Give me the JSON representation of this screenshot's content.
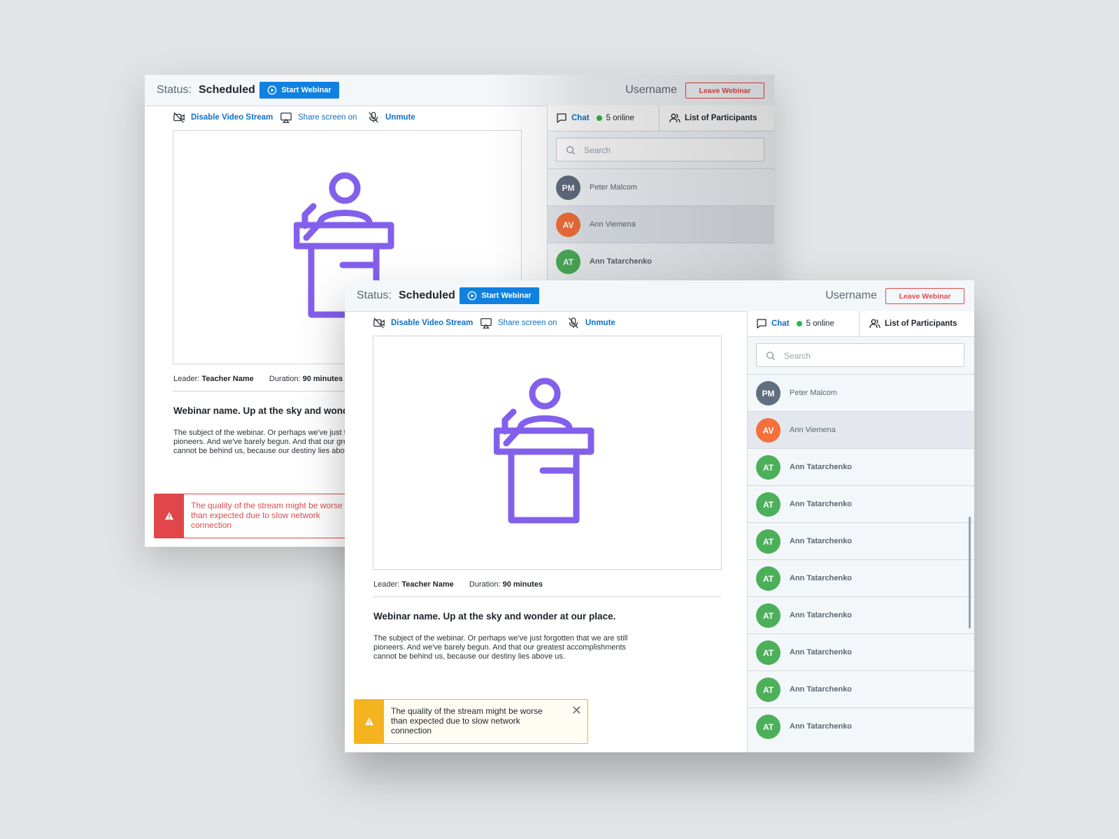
{
  "colors": {
    "accent": "#1081e0",
    "link": "#1070c8",
    "danger": "#e04a4a",
    "warning": "#f3b420",
    "online": "#2fb84c",
    "podium": "#8360ec"
  },
  "windows": [
    {
      "header": {
        "status_label": "Status:",
        "status_value": "Scheduled",
        "start_button": "Start Webinar",
        "username": "Username",
        "leave_button": "Leave Webinar"
      },
      "toolbar": {
        "video": "Disable Video Stream",
        "share": "Share screen on",
        "unmute": "Unmute"
      },
      "meta": {
        "leader_label": "Leader:",
        "leader_value": "Teacher Name",
        "duration_label": "Duration:",
        "duration_value": "90 minutes"
      },
      "webinar_title": "Webinar name. Up at the sky and wonder at our place.",
      "description": "The subject of the webinar. Or perhaps we've just forgotten that we are still pioneers. And we've barely begun. And that our greatest accomplishments cannot be behind us, because our destiny lies above us.",
      "toast": {
        "type": "error",
        "message": "The quality of the stream might be worse than expected due to slow network connection"
      },
      "sidebar": {
        "chat_tab": "Chat",
        "online_count": "5 online",
        "participants_tab": "List of Participants",
        "search_placeholder": "Search",
        "participants": [
          {
            "initials": "PM",
            "name": "Peter Malcom",
            "color": "#616e7f"
          },
          {
            "initials": "AV",
            "name": "Ann Viemena",
            "color": "#f5703a"
          },
          {
            "initials": "AT",
            "name": "Ann Tatarchenko",
            "color": "#4cb05a"
          }
        ]
      }
    },
    {
      "header": {
        "status_label": "Status:",
        "status_value": "Scheduled",
        "start_button": "Start Webinar",
        "username": "Username",
        "leave_button": "Leave Webinar"
      },
      "toolbar": {
        "video": "Disable Video Stream",
        "share": "Share screen on",
        "unmute": "Unmute"
      },
      "meta": {
        "leader_label": "Leader:",
        "leader_value": "Teacher Name",
        "duration_label": "Duration:",
        "duration_value": "90 minutes"
      },
      "webinar_title": "Webinar name. Up at the sky and wonder at our place.",
      "description": "The subject of the webinar. Or perhaps we've just forgotten that we are still pioneers. And we've barely begun. And that our greatest accomplishments cannot be behind us, because our destiny lies above us.",
      "toast": {
        "type": "warning",
        "message": "The quality of the stream might be worse than expected due to slow network connection",
        "close": "✕"
      },
      "sidebar": {
        "chat_tab": "Chat",
        "online_count": "5 online",
        "participants_tab": "List of Participants",
        "search_placeholder": "Search",
        "participants": [
          {
            "initials": "PM",
            "name": "Peter Malcom",
            "color": "#616e7f"
          },
          {
            "initials": "AV",
            "name": "Ann Viemena",
            "color": "#f5703a"
          },
          {
            "initials": "AT",
            "name": "Ann Tatarchenko",
            "color": "#4cb05a"
          },
          {
            "initials": "AT",
            "name": "Ann Tatarchenko",
            "color": "#4cb05a"
          },
          {
            "initials": "AT",
            "name": "Ann Tatarchenko",
            "color": "#4cb05a"
          },
          {
            "initials": "AT",
            "name": "Ann Tatarchenko",
            "color": "#4cb05a"
          },
          {
            "initials": "AT",
            "name": "Ann Tatarchenko",
            "color": "#4cb05a"
          },
          {
            "initials": "AT",
            "name": "Ann Tatarchenko",
            "color": "#4cb05a"
          },
          {
            "initials": "AT",
            "name": "Ann Tatarchenko",
            "color": "#4cb05a"
          },
          {
            "initials": "AT",
            "name": "Ann Tatarchenko",
            "color": "#4cb05a"
          }
        ]
      }
    }
  ]
}
